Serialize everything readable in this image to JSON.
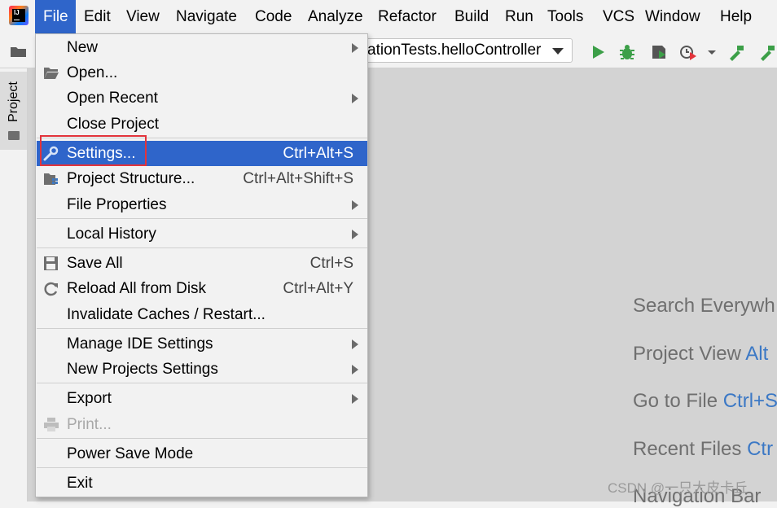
{
  "menubar": {
    "items": [
      "File",
      "Edit",
      "View",
      "Navigate",
      "Code",
      "Analyze",
      "Refactor",
      "Build",
      "Run",
      "Tools",
      "VCS",
      "Window",
      "Help"
    ]
  },
  "app_logo_text": "IJ",
  "toolbar": {
    "run_config": "ationTests.helloController"
  },
  "left_panel": {
    "project_tab": "Project"
  },
  "file_menu": {
    "items": [
      {
        "label": "New",
        "submenu": true
      },
      {
        "label": "Open...",
        "icon": "folder-open-icon"
      },
      {
        "label": "Open Recent",
        "submenu": true
      },
      {
        "label": "Close Project"
      },
      {
        "label": "Settings...",
        "shortcut": "Ctrl+Alt+S",
        "icon": "wrench-icon",
        "selected": true
      },
      {
        "label": "Project Structure...",
        "shortcut": "Ctrl+Alt+Shift+S",
        "icon": "project-structure-icon"
      },
      {
        "label": "File Properties",
        "submenu": true
      },
      {
        "label": "Local History",
        "submenu": true
      },
      {
        "label": "Save All",
        "shortcut": "Ctrl+S",
        "icon": "save-icon"
      },
      {
        "label": "Reload All from Disk",
        "shortcut": "Ctrl+Alt+Y",
        "icon": "reload-icon"
      },
      {
        "label": "Invalidate Caches / Restart..."
      },
      {
        "label": "Manage IDE Settings",
        "submenu": true
      },
      {
        "label": "New Projects Settings",
        "submenu": true
      },
      {
        "label": "Export",
        "submenu": true
      },
      {
        "label": "Print...",
        "icon": "print-icon",
        "disabled": true
      },
      {
        "label": "Power Save Mode"
      },
      {
        "label": "Exit"
      }
    ]
  },
  "editor_hints": [
    {
      "text": "Search Everywh",
      "key": ""
    },
    {
      "text": "Project View ",
      "key": "Alt"
    },
    {
      "text": "Go to File ",
      "key": "Ctrl+S"
    },
    {
      "text": "Recent Files ",
      "key": "Ctr"
    },
    {
      "text": "Navigation Bar",
      "key": ""
    }
  ],
  "watermark": "CSDN @一只大皮卡丘",
  "colors": {
    "menu_bg": "#f2f2f2",
    "selection": "#2f65ca",
    "highlight_border": "#e2333b",
    "editor_bg": "#d3d3d3",
    "shortcut_key": "#3b78c5"
  }
}
